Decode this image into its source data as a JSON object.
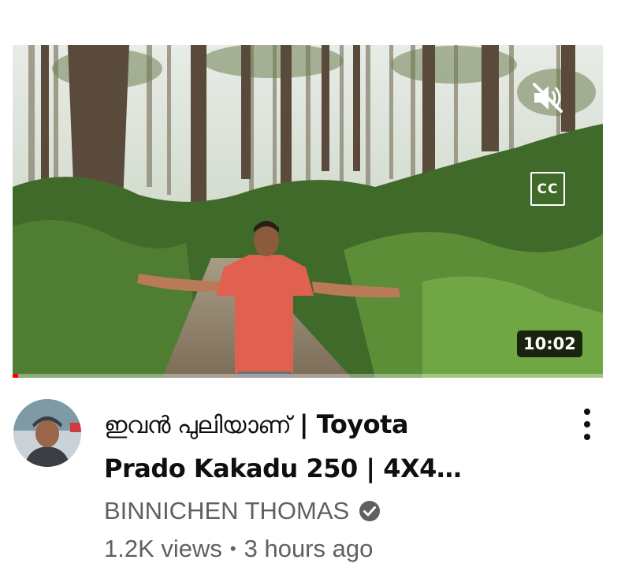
{
  "video": {
    "title_malayalam": "ഇവൻ പുലിയാണ്",
    "title_line1_rest": " | Toyota",
    "title_line2": "Prado Kakadu 250 | 4X4…",
    "duration": "10:02",
    "progress_fraction": 0.01,
    "channel_name": "BINNICHEN THOMAS",
    "views": "1.2K views",
    "separator": "•",
    "age": "3 hours ago"
  },
  "icons": {
    "mute": "volume-muted-icon",
    "captions": "closed-captions-icon",
    "verified": "verified-check-icon",
    "more": "more-vertical-icon"
  },
  "captions_label": "CC",
  "colors": {
    "progress": "#ff0000",
    "text_primary": "#0f0f0f",
    "text_secondary": "#606060"
  }
}
